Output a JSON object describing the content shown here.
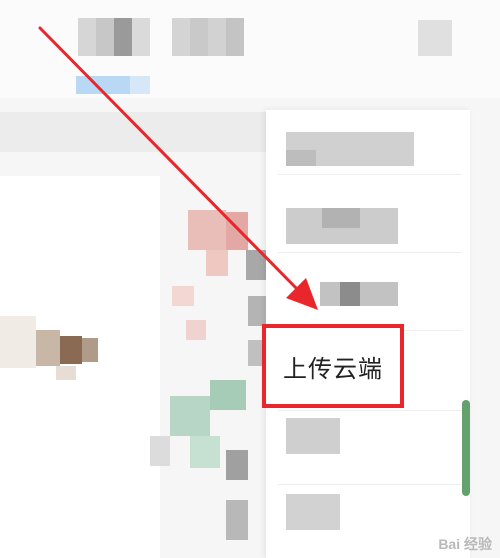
{
  "menu": {
    "highlighted_item_label": "上传云端"
  },
  "annotation": {
    "arrow_color": "#e8262b",
    "highlight_color": "#e8262b"
  },
  "watermark": {
    "text": "Bai 经验"
  }
}
